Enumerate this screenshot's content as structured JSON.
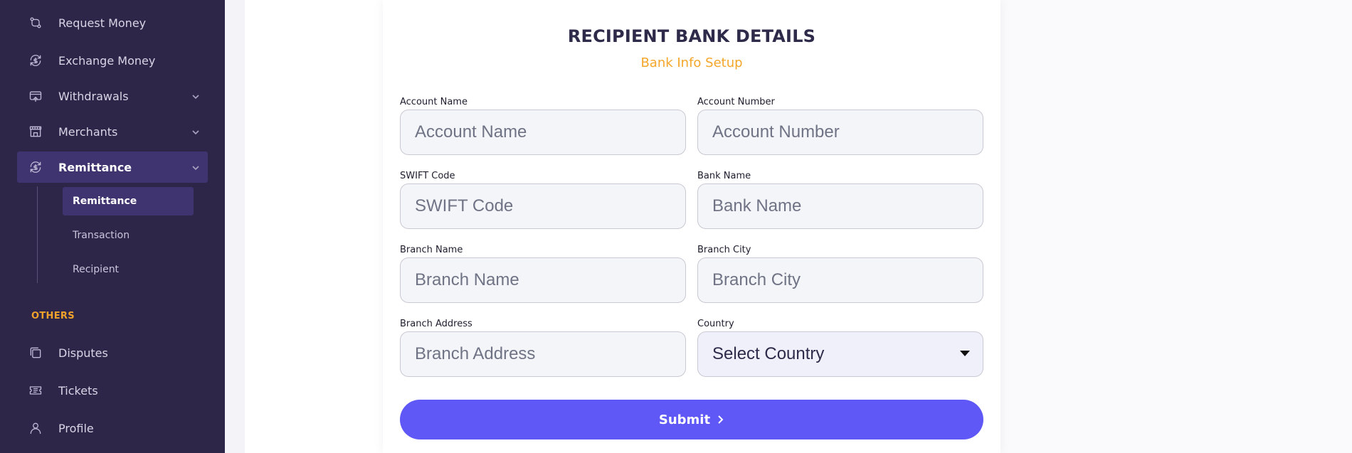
{
  "sidebar": {
    "items": [
      {
        "label": "Request Money",
        "icon": "request-money-icon"
      },
      {
        "label": "Exchange Money",
        "icon": "exchange-icon"
      },
      {
        "label": "Withdrawals",
        "icon": "withdraw-icon"
      },
      {
        "label": "Merchants",
        "icon": "store-icon"
      },
      {
        "label": "Remittance",
        "icon": "remittance-icon"
      }
    ],
    "remittance_sub": [
      {
        "label": "Remittance"
      },
      {
        "label": "Transaction"
      },
      {
        "label": "Recipient"
      }
    ],
    "section_others": "OTHERS",
    "others_items": [
      {
        "label": "Disputes",
        "icon": "disputes-icon"
      },
      {
        "label": "Tickets",
        "icon": "ticket-icon"
      },
      {
        "label": "Profile",
        "icon": "user-icon"
      }
    ]
  },
  "form": {
    "title": "RECIPIENT BANK DETAILS",
    "subtitle": "Bank Info Setup",
    "fields": {
      "account_name": {
        "label": "Account Name",
        "placeholder": "Account Name",
        "value": ""
      },
      "account_number": {
        "label": "Account Number",
        "placeholder": "Account Number",
        "value": ""
      },
      "swift_code": {
        "label": "SWIFT Code",
        "placeholder": "SWIFT Code",
        "value": ""
      },
      "bank_name": {
        "label": "Bank Name",
        "placeholder": "Bank Name",
        "value": ""
      },
      "branch_name": {
        "label": "Branch Name",
        "placeholder": "Branch Name",
        "value": ""
      },
      "branch_city": {
        "label": "Branch City",
        "placeholder": "Branch City",
        "value": ""
      },
      "branch_address": {
        "label": "Branch Address",
        "placeholder": "Branch Address",
        "value": ""
      },
      "country": {
        "label": "Country",
        "selected": "Select Country"
      }
    },
    "submit_label": "Submit"
  },
  "colors": {
    "sidebar_bg": "#2e2649",
    "sidebar_active": "#3f3470",
    "accent_orange": "#f4a62a",
    "primary_button": "#5f58f6",
    "title_text": "#2d2a4a"
  }
}
